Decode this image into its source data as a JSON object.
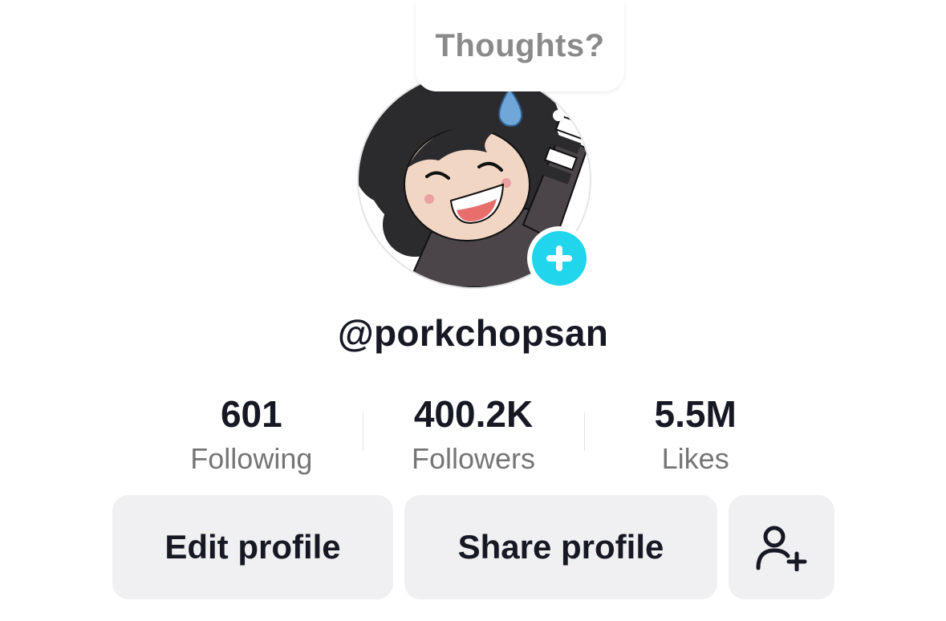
{
  "thoughts_bubble": {
    "label": "Thoughts?"
  },
  "profile": {
    "username": "@porkchopsan",
    "avatar_icon": "cartoon-avatar",
    "add_icon": "plus-icon",
    "accent_color": "#20d5ec"
  },
  "stats": [
    {
      "value": "601",
      "label": "Following"
    },
    {
      "value": "400.2K",
      "label": "Followers"
    },
    {
      "value": "5.5M",
      "label": "Likes"
    }
  ],
  "actions": {
    "edit_label": "Edit profile",
    "share_label": "Share profile",
    "add_friend_icon": "add-friend-icon"
  }
}
